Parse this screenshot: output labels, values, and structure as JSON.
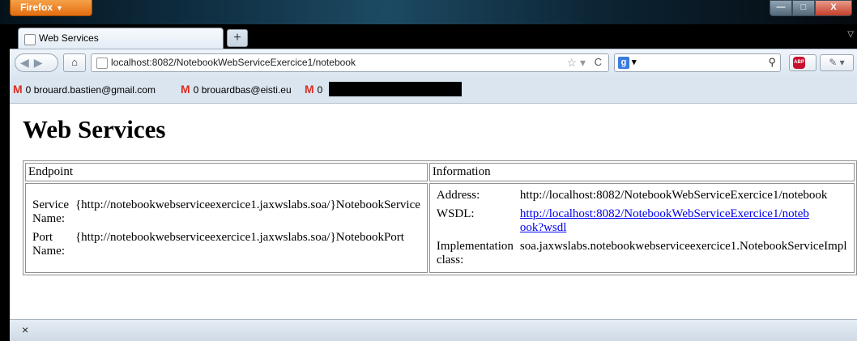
{
  "window": {
    "app_button": "Firefox",
    "controls": {
      "minimize": "—",
      "maximize": "□",
      "close": "X"
    }
  },
  "tabs": [
    {
      "title": "Web Services"
    }
  ],
  "new_tab": "+",
  "nav": {
    "url": "localhost:8082/NotebookWebServiceExercice1/notebook",
    "search_value": ""
  },
  "bookmarks": [
    {
      "count": "0",
      "label": "brouard.bastien@gmail.com"
    },
    {
      "count": "0",
      "label": "brouardbas@eisti.eu"
    },
    {
      "count": "0",
      "label": ""
    }
  ],
  "page": {
    "heading": "Web Services",
    "table": {
      "headers": [
        "Endpoint",
        "Information"
      ],
      "endpoint": [
        {
          "label": "Service Name:",
          "value": "{http://notebookwebserviceexercice1.jaxwslabs.soa/}NotebookService"
        },
        {
          "label": "Port Name:",
          "value": "{http://notebookwebserviceexercice1.jaxwslabs.soa/}NotebookPort"
        }
      ],
      "information": [
        {
          "label": "Address:",
          "value": "http://localhost:8082/NotebookWebServiceExercice1/notebook"
        },
        {
          "label": "WSDL:",
          "value": "http://localhost:8082/NotebookWebServiceExercice1/notebook?wsdl"
        },
        {
          "label": "Implementation class:",
          "value": "soa.jaxwslabs.notebookwebserviceexercice1.NotebookServiceImpl"
        }
      ]
    }
  },
  "status": {
    "close": "×"
  },
  "colors": {
    "link": "#0000ee",
    "firefox_button": "#e36d10",
    "gmail_red": "#d93025"
  }
}
